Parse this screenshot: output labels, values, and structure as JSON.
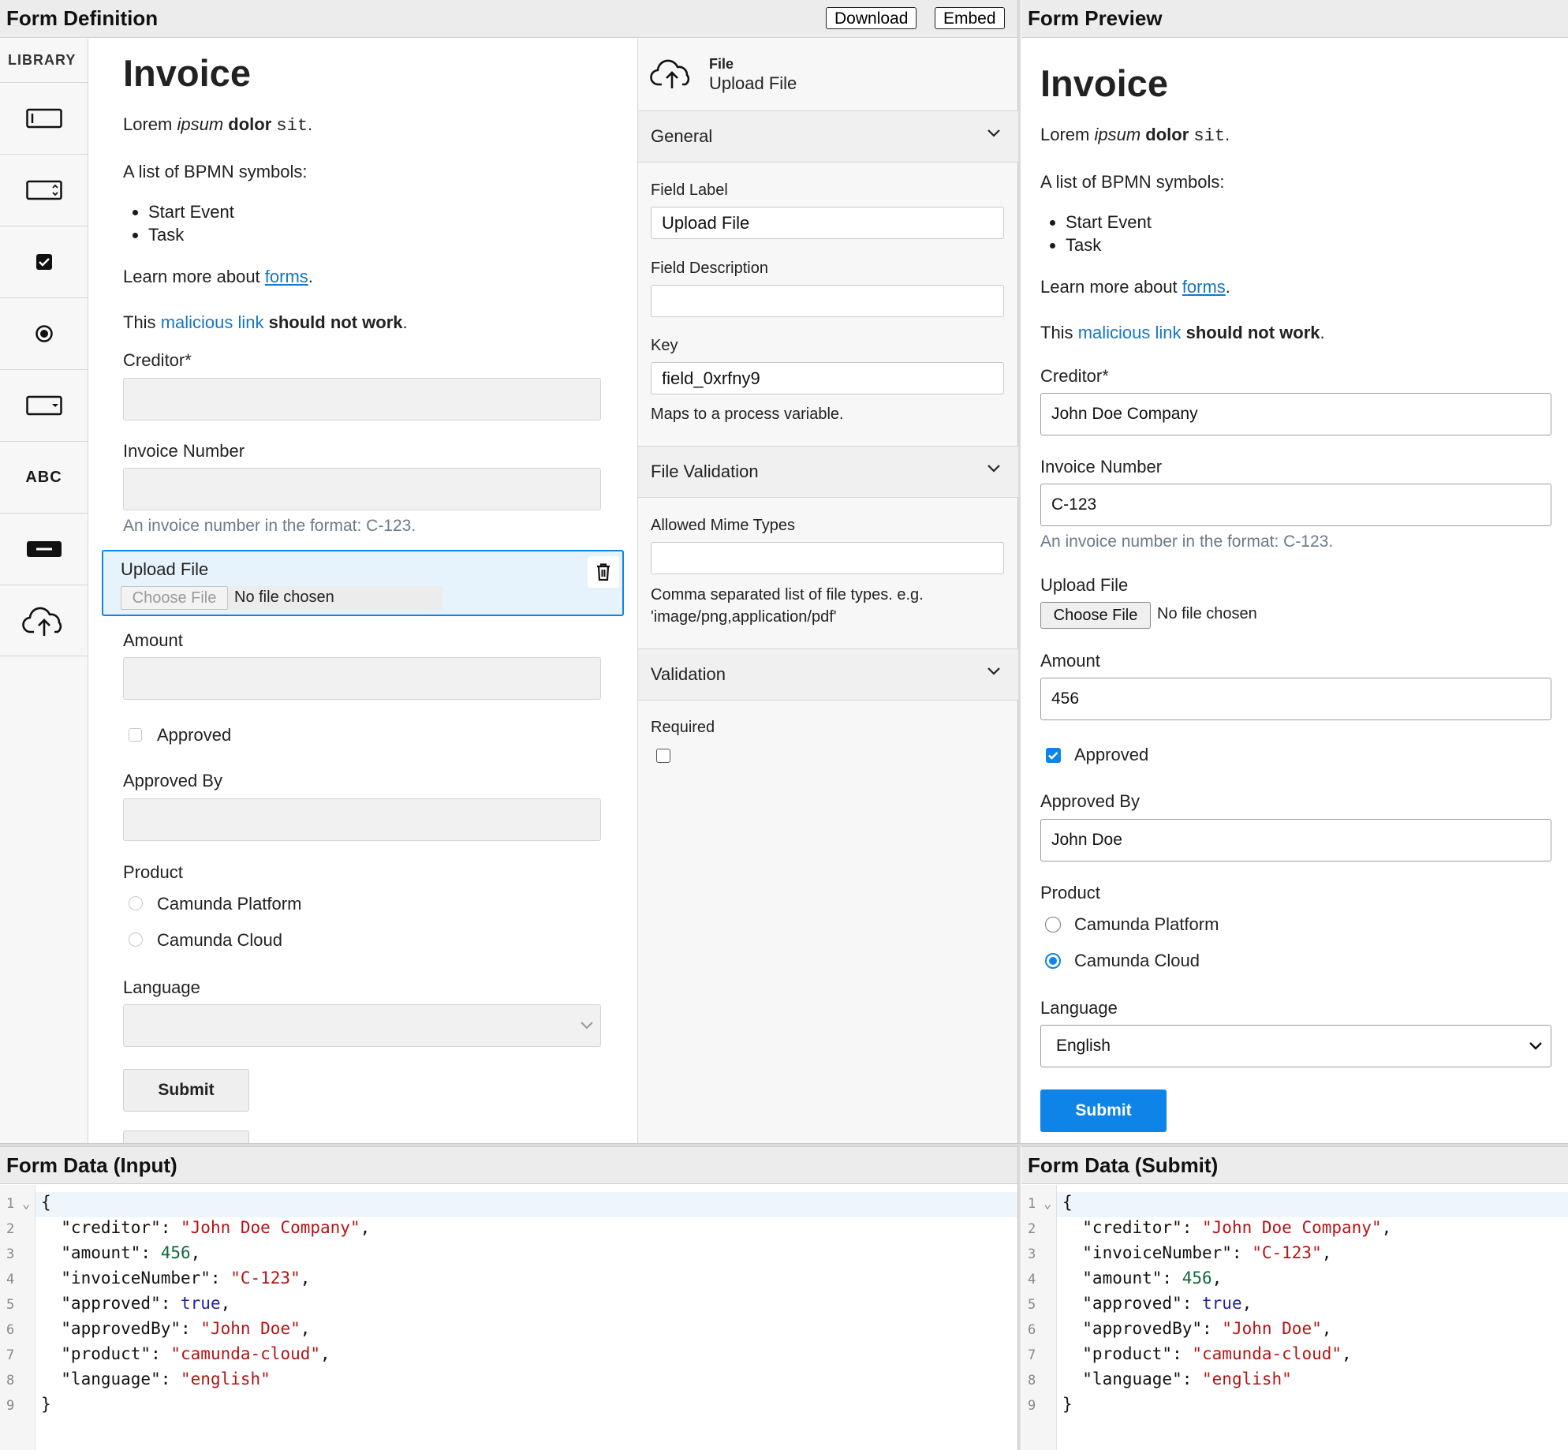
{
  "panels": {
    "form_definition": "Form Definition",
    "form_preview": "Form Preview",
    "form_data_input": "Form Data (Input)",
    "form_data_submit": "Form Data (Submit)"
  },
  "toolbar": {
    "download": "Download",
    "embed": "Embed"
  },
  "library": {
    "title": "LIBRARY",
    "items": [
      "textfield-icon",
      "number-icon",
      "checkbox-icon",
      "radio-icon",
      "select-icon",
      "text-icon",
      "button-icon",
      "file-upload-icon"
    ],
    "text_item_label": "ABC"
  },
  "form": {
    "title": "Invoice",
    "intro": {
      "p1": "Lorem ",
      "p2": "ipsum",
      "p3": " ",
      "p4": "dolor",
      "p5": " ",
      "p6": "sit",
      "p7": "."
    },
    "list_intro": "A list of BPMN symbols:",
    "list": [
      "Start Event",
      "Task"
    ],
    "learn_prefix": "Learn more about ",
    "learn_link": "forms",
    "learn_suffix": ".",
    "malicious_prefix": "This ",
    "malicious_link": "malicious link",
    "malicious_bold": " should not work",
    "malicious_suffix": ".",
    "creditor_label": "Creditor*",
    "invoice_label": "Invoice Number",
    "invoice_desc": "An invoice number in the format: C-123.",
    "upload_label": "Upload File",
    "choose_file": "Choose File",
    "no_file": "No file chosen",
    "amount_label": "Amount",
    "approved_label": "Approved",
    "approved_by_label": "Approved By",
    "product_label": "Product",
    "product_options": [
      "Camunda Platform",
      "Camunda Cloud"
    ],
    "language_label": "Language",
    "submit": "Submit"
  },
  "properties": {
    "header_type": "File",
    "header_name": "Upload File",
    "general": "General",
    "field_label": "Field Label",
    "field_label_value": "Upload File",
    "field_description": "Field Description",
    "field_description_value": "",
    "key": "Key",
    "key_value": "field_0xrfny9",
    "key_hint": "Maps to a process variable.",
    "file_validation": "File Validation",
    "allowed_mime": "Allowed Mime Types",
    "allowed_mime_value": "",
    "mime_hint_1": "Comma separated list of file types. e.g.",
    "mime_hint_2": "'image/png,application/pdf'",
    "validation": "Validation",
    "required": "Required"
  },
  "preview": {
    "creditor_value": "John Doe Company",
    "invoice_value": "C-123",
    "amount_value": "456",
    "approved_by_value": "John Doe",
    "language_value": "English",
    "selected_product": "Camunda Cloud",
    "approved_checked": true
  },
  "code_input": {
    "lines": [
      "{",
      "  \"creditor\": ",
      "  \"amount\": ",
      "  \"invoiceNumber\": ",
      "  \"approved\": ",
      "  \"approvedBy\": ",
      "  \"product\": ",
      "  \"language\": ",
      "}"
    ],
    "values": [
      "",
      "\"John Doe Company\"",
      "456",
      "\"C-123\"",
      "true",
      "\"John Doe\"",
      "\"camunda-cloud\"",
      "\"english\"",
      ""
    ],
    "suffix": [
      "",
      ",",
      ",",
      ",",
      ",",
      ",",
      ",",
      "",
      ""
    ]
  },
  "code_submit": {
    "lines": [
      "{",
      "  \"creditor\": ",
      "  \"invoiceNumber\": ",
      "  \"amount\": ",
      "  \"approved\": ",
      "  \"approvedBy\": ",
      "  \"product\": ",
      "  \"language\": ",
      "}"
    ],
    "values": [
      "",
      "\"John Doe Company\"",
      "\"C-123\"",
      "456",
      "true",
      "\"John Doe\"",
      "\"camunda-cloud\"",
      "\"english\"",
      ""
    ],
    "suffix": [
      "",
      ",",
      ",",
      ",",
      ",",
      ",",
      ",",
      "",
      ""
    ]
  },
  "line_numbers": [
    "1",
    "2",
    "3",
    "4",
    "5",
    "6",
    "7",
    "8",
    "9"
  ],
  "colors": {
    "accent": "#0f84e8",
    "link": "#1676c4",
    "selected_bg": "#e6f3fc",
    "string": "#b31414",
    "number": "#11693a",
    "bool": "#2323a0"
  }
}
